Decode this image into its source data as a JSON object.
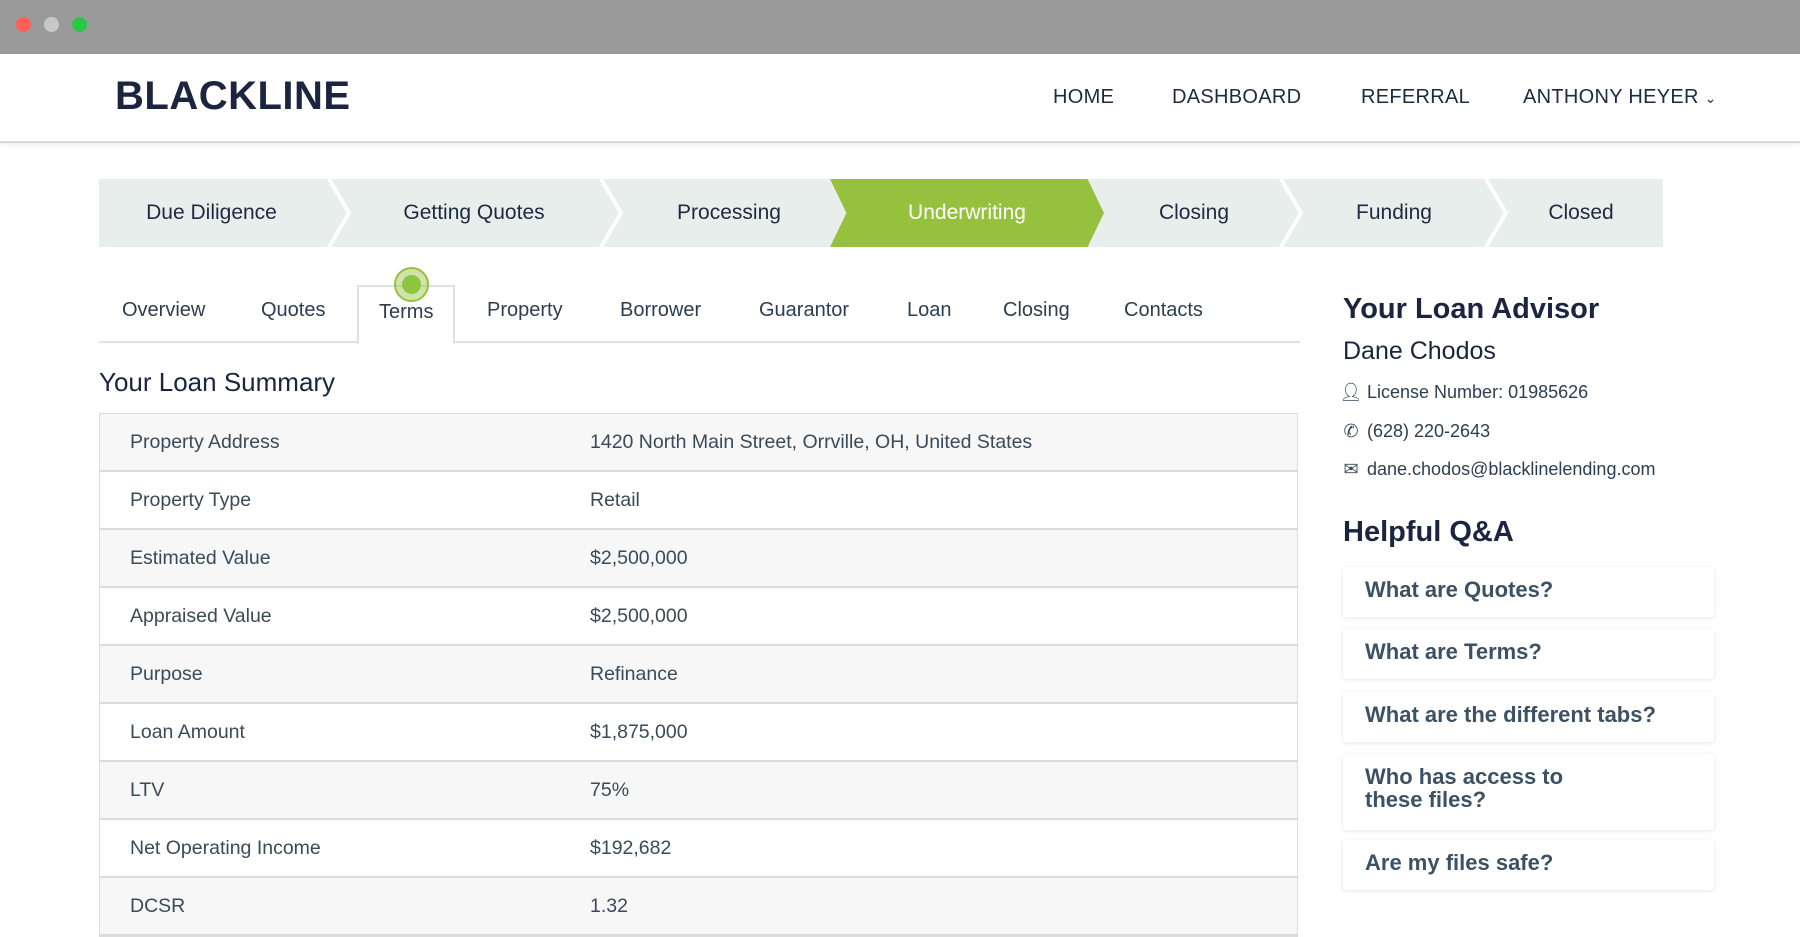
{
  "window": {
    "controls": {
      "close": "#fe5f57",
      "minimize": "#c8c8c8",
      "maximize": "#28c840"
    }
  },
  "header": {
    "logo": "BLACKLINE",
    "nav": [
      "HOME",
      "DASHBOARD",
      "REFERRAL",
      "ANTHONY HEYER"
    ],
    "user_menu_icon": "chevron-down-icon"
  },
  "stepper": {
    "steps": [
      "Due Diligence",
      "Getting Quotes",
      "Processing",
      "Underwriting",
      "Closing",
      "Funding",
      "Closed"
    ],
    "active": "Underwriting",
    "accent": "#96c13f"
  },
  "tabs": {
    "items": [
      "Overview",
      "Quotes",
      "Terms",
      "Property",
      "Borrower",
      "Guarantor",
      "Loan",
      "Closing",
      "Contacts"
    ],
    "active": "Terms"
  },
  "summary": {
    "title": "Your Loan Summary",
    "rows": [
      {
        "label": "Property Address",
        "value": "1420 North Main Street, Orrville, OH, United States"
      },
      {
        "label": "Property Type",
        "value": "Retail"
      },
      {
        "label": "Estimated Value",
        "value": "$2,500,000"
      },
      {
        "label": "Appraised Value",
        "value": "$2,500,000"
      },
      {
        "label": "Purpose",
        "value": "Refinance"
      },
      {
        "label": "Loan Amount",
        "value": "$1,875,000"
      },
      {
        "label": "LTV",
        "value": "75%"
      },
      {
        "label": "Net Operating Income",
        "value": "$192,682"
      },
      {
        "label": "DCSR",
        "value": "1.32"
      }
    ]
  },
  "advisor": {
    "title": "Your Loan Advisor",
    "name": "Dane Chodos",
    "license": "License Number: 01985626",
    "phone": "(628) 220-2643",
    "email": "dane.chodos@blacklinelending.com"
  },
  "qa": {
    "title": "Helpful Q&A",
    "items": [
      "What are Quotes?",
      "What are Terms?",
      "What are the different tabs?",
      "Who has access to these files?",
      "Are my files safe?"
    ]
  }
}
